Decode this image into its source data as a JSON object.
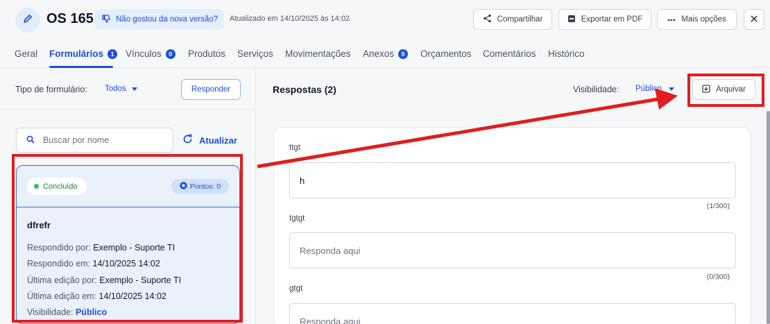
{
  "header": {
    "title": "OS 165",
    "feedback_label": "Não gostou da nova versão?",
    "updated_text": "Atualizado em 14/10/2025 às 14:02",
    "share_label": "Compartilhar",
    "pdf_label": "Exportar em PDF",
    "more_label": "Mais opções"
  },
  "tabs": [
    {
      "label": "Geral"
    },
    {
      "label": "Formulários",
      "badge": "1"
    },
    {
      "label": "Vínculos",
      "badge": "0"
    },
    {
      "label": "Produtos"
    },
    {
      "label": "Serviços"
    },
    {
      "label": "Movimentações"
    },
    {
      "label": "Anexos",
      "badge": "0"
    },
    {
      "label": "Orçamentos"
    },
    {
      "label": "Comentários"
    },
    {
      "label": "Histórico"
    }
  ],
  "left": {
    "form_type_label": "Tipo de formulário:",
    "form_type_value": "Todos",
    "respond_label": "Responder",
    "search_placeholder": "Buscar por nome",
    "refresh_label": "Atualizar",
    "card": {
      "status": "Concluído",
      "points": "Pontos: 0",
      "name": "dfrefr",
      "answered_by_label": "Respondido por:",
      "answered_by": "Exemplo - Suporte TI",
      "answered_at_label": "Respondido em:",
      "answered_at": "14/10/2025 14:02",
      "edited_by_label": "Última edição por:",
      "edited_by": "Exemplo - Suporte TI",
      "edited_at_label": "Última edição em:",
      "edited_at": "14/10/2025 14:02",
      "visibility_label": "Visibilidade:",
      "visibility": "Público"
    }
  },
  "right": {
    "title": "Respostas (2)",
    "visibility_label": "Visibilidade:",
    "visibility_value": "Público",
    "archive_label": "Arquivar",
    "questions": [
      {
        "label": "ttgt",
        "value": "h",
        "counter": "(1/300)"
      },
      {
        "label": "tgtgt",
        "placeholder": "Responda aqui",
        "counter": "(0/300)"
      },
      {
        "label": "gtgt",
        "placeholder": "Responda aqui"
      }
    ]
  },
  "colors": {
    "accent": "#1d4ed8",
    "highlight": "#e11d1d",
    "success": "#22c55e"
  }
}
